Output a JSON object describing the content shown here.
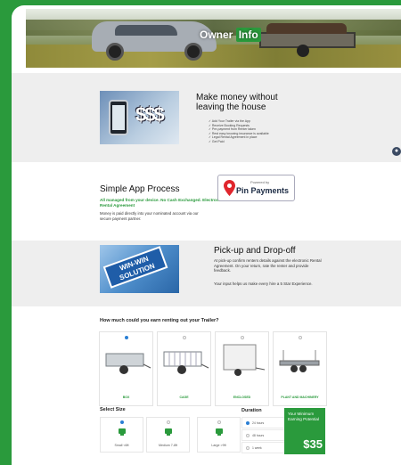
{
  "hero": {
    "title_a": "Owner ",
    "title_b": "Info"
  },
  "section_money": {
    "heading": "Make money without leaving the house",
    "bullets": [
      "Add Your Trailer via the App",
      "Receive Booking Requests",
      "Pre-payment from Renter taken",
      "Rest easy knowing insurance is available",
      "Legal Rental Agreement in place",
      "Get Paid"
    ]
  },
  "section_app": {
    "heading": "Simple App Process",
    "green_text": "All managed from your device. No Cash Exchanged. Electronic Rental Agreement",
    "body": "Money is paid directly into your nominated account via our secure payment partner.",
    "partner_powered": "Powered by",
    "partner_name": "Pin Payments"
  },
  "section_pickup": {
    "heading": "Pick-up and Drop-off",
    "body1": "At pick-up confirm renters details against the electronic Rental Agreement. On your return, rate the renter and provide feedback.",
    "body2": "Your input helps us make every hire a 5 Star Experience.",
    "image_text": "WIN-WIN SOLUTION"
  },
  "calculator": {
    "question": "How much could you earn renting out your Trailer?",
    "trailer_types": [
      "BOX",
      "CAGE",
      "ENCLOSED",
      "PLANT AND MACHINERY"
    ],
    "selected_type": 0,
    "select_size_label": "Select Size",
    "sizes": [
      "Small <6ft",
      "Medium 7-8ft",
      "Large >9ft"
    ],
    "selected_size": 0,
    "duration_label": "Duration",
    "durations": [
      "24 hours",
      "48 hours",
      "1 week"
    ],
    "selected_duration": 0,
    "earning_label": "Your Minimum Earning Potential",
    "earning_value": "$35"
  },
  "colors": {
    "brand_green": "#2a9a3c",
    "accent_blue": "#2a7fd4"
  }
}
